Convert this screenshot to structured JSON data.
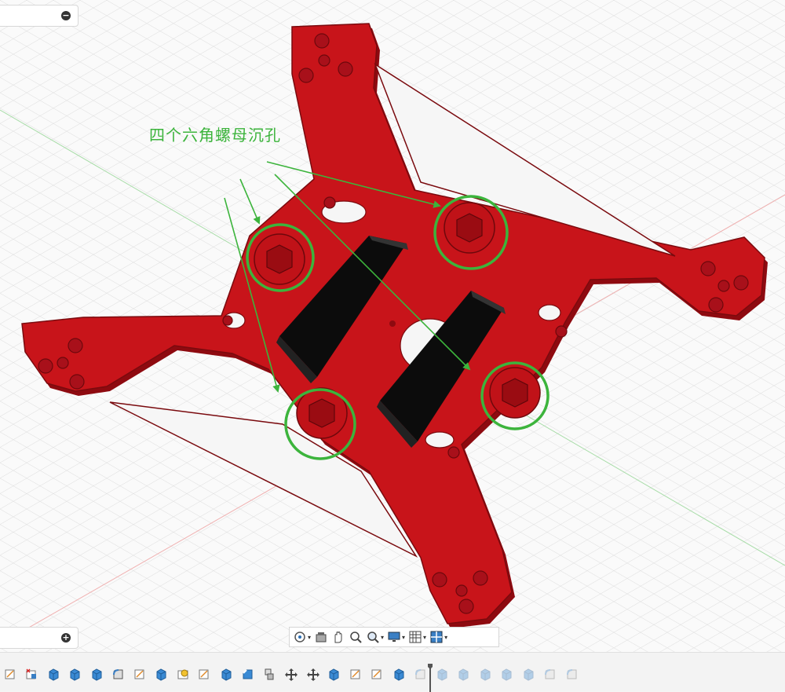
{
  "annotation": {
    "label": "四个六角螺母沉孔"
  },
  "panels": [
    {
      "name": "top-panel",
      "toggle": "−"
    },
    {
      "name": "bottom-panel",
      "toggle": "+"
    }
  ],
  "nav_toolbar": {
    "items": [
      {
        "name": "orbit-icon",
        "caret": "▾"
      },
      {
        "name": "look-at-icon",
        "caret": ""
      },
      {
        "name": "pan-icon",
        "caret": ""
      },
      {
        "name": "zoom-icon",
        "caret": ""
      },
      {
        "name": "fit-icon",
        "caret": "▾"
      },
      {
        "name": "display-settings-icon",
        "caret": "▾"
      },
      {
        "name": "grid-settings-icon",
        "caret": "▾"
      },
      {
        "name": "viewports-icon",
        "caret": "▾"
      }
    ]
  },
  "timeline": {
    "features": [
      "sketch",
      "delete-sketch",
      "extrude",
      "extrude",
      "extrude",
      "fillet",
      "sketch",
      "extrude",
      "hole",
      "sketch",
      "extrude",
      "chamfer",
      "combine",
      "move",
      "move",
      "extrude",
      "sketch",
      "sketch",
      "extrude",
      "fillet",
      "extrude",
      "extrude",
      "extrude",
      "extrude",
      "extrude",
      "fillet",
      "fillet"
    ],
    "marker_after": 19
  },
  "colors": {
    "part": "#c8141a",
    "part_dark": "#8e0a10",
    "part_shadow": "#a20e14",
    "bracket": "#111111",
    "annotation": "#3cb43c",
    "grid": "#dcdcdc"
  }
}
